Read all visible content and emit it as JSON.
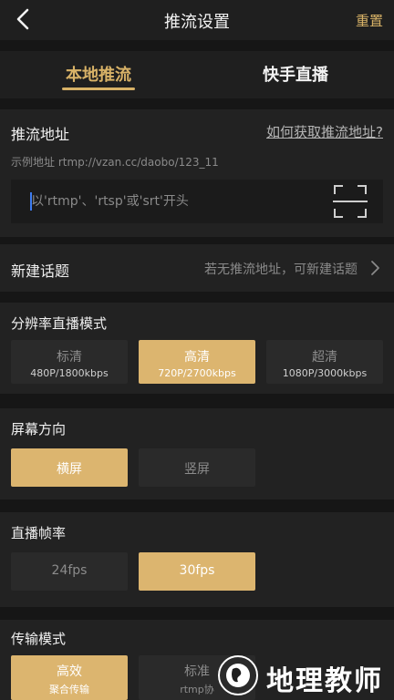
{
  "header": {
    "title": "推流设置",
    "reset_label": "重置"
  },
  "tabs": [
    {
      "label": "本地推流",
      "active": true
    },
    {
      "label": "快手直播",
      "active": false
    }
  ],
  "push_address": {
    "title": "推流地址",
    "help_link": "如何获取推流地址?",
    "example": "示例地址 rtmp://vzan.cc/daobo/123_11",
    "placeholder": "以'rtmp'、'rtsp'或'srt'开头",
    "value": ""
  },
  "new_topic": {
    "label": "新建话题",
    "hint": "若无推流地址，可新建话题"
  },
  "resolution": {
    "title": "分辨率直播模式",
    "options": [
      {
        "label": "标清",
        "detail": "480P/1800kbps",
        "selected": false
      },
      {
        "label": "高清",
        "detail": "720P/2700kbps",
        "selected": true
      },
      {
        "label": "超清",
        "detail": "1080P/3000kbps",
        "selected": false
      }
    ]
  },
  "orientation": {
    "title": "屏幕方向",
    "options": [
      {
        "label": "横屏",
        "selected": true
      },
      {
        "label": "竖屏",
        "selected": false
      }
    ]
  },
  "frame_rate": {
    "title": "直播帧率",
    "options": [
      {
        "label": "24fps",
        "selected": false
      },
      {
        "label": "30fps",
        "selected": true
      }
    ]
  },
  "transport": {
    "title": "传输模式",
    "options": [
      {
        "label": "高效",
        "detail": "聚合传输",
        "selected": true
      },
      {
        "label": "标准",
        "detail": "rtmp协",
        "selected": false
      }
    ]
  },
  "watermark": {
    "text": "地理教师"
  },
  "colors": {
    "accent": "#d8b267",
    "selected_bg": "#dcb56f",
    "background": "#1d1d1d",
    "card": "#222222",
    "option_bg": "#2a2a2a"
  }
}
